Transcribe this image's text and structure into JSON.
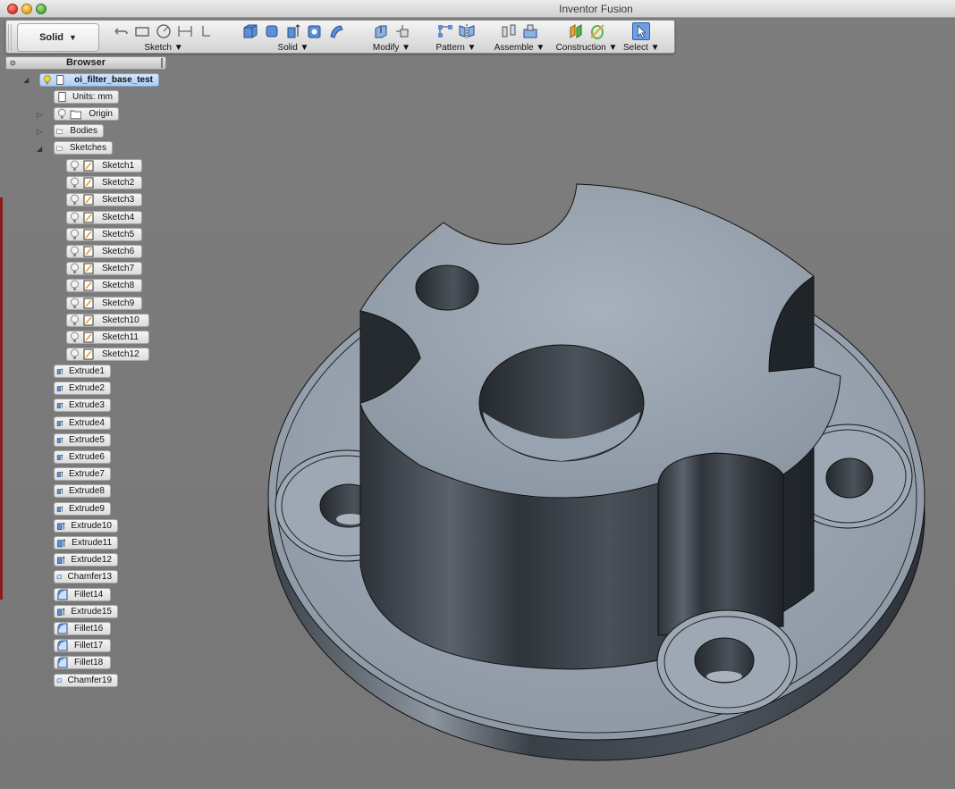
{
  "window": {
    "title": "Inventor Fusion"
  },
  "ribbon": {
    "mode_label": "Solid",
    "groups": [
      {
        "label": "Sketch"
      },
      {
        "label": "Solid"
      },
      {
        "label": "Modify"
      },
      {
        "label": "Pattern"
      },
      {
        "label": "Assemble"
      },
      {
        "label": "Construction"
      },
      {
        "label": "Select"
      }
    ]
  },
  "browser": {
    "header": "Browser",
    "root": "oi_filter_base_test",
    "units": "Units: mm",
    "folders": [
      "Origin",
      "Bodies",
      "Sketches"
    ],
    "sketches": [
      "Sketch1",
      "Sketch2",
      "Sketch3",
      "Sketch4",
      "Sketch5",
      "Sketch6",
      "Sketch7",
      "Sketch8",
      "Sketch9",
      "Sketch10",
      "Sketch11",
      "Sketch12"
    ],
    "features": [
      {
        "label": "Extrude1",
        "icon": "extrude-icon"
      },
      {
        "label": "Extrude2",
        "icon": "extrude-icon"
      },
      {
        "label": "Extrude3",
        "icon": "extrude-icon"
      },
      {
        "label": "Extrude4",
        "icon": "extrude-icon"
      },
      {
        "label": "Extrude5",
        "icon": "extrude-icon"
      },
      {
        "label": "Extrude6",
        "icon": "extrude-icon"
      },
      {
        "label": "Extrude7",
        "icon": "extrude-icon"
      },
      {
        "label": "Extrude8",
        "icon": "extrude-icon"
      },
      {
        "label": "Extrude9",
        "icon": "extrude-icon"
      },
      {
        "label": "Extrude10",
        "icon": "extrude-icon"
      },
      {
        "label": "Extrude11",
        "icon": "extrude-icon"
      },
      {
        "label": "Extrude12",
        "icon": "extrude-icon"
      },
      {
        "label": "Chamfer13",
        "icon": "chamfer-icon"
      },
      {
        "label": "Fillet14",
        "icon": "fillet-icon"
      },
      {
        "label": "Extrude15",
        "icon": "extrude-icon"
      },
      {
        "label": "Fillet16",
        "icon": "fillet-icon"
      },
      {
        "label": "Fillet17",
        "icon": "fillet-icon"
      },
      {
        "label": "Fillet18",
        "icon": "fillet-icon"
      },
      {
        "label": "Chamfer19",
        "icon": "chamfer-icon"
      }
    ]
  },
  "colors": {
    "viewport_bg": "#7b7b7b",
    "model_face": "#9aa6b3",
    "model_wall": "#3c424a",
    "selection_blue": "#aecdf2"
  }
}
